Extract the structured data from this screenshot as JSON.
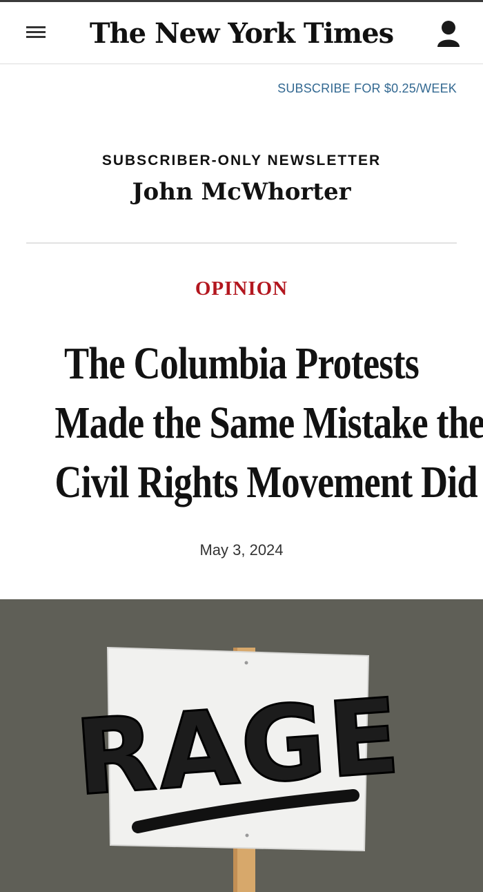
{
  "masthead": {
    "logo_text": "The New York Times",
    "menu_icon": "hamburger-menu-icon",
    "account_icon": "user-account-icon"
  },
  "subscribe": {
    "label": "SUBSCRIBE FOR $0.25/WEEK"
  },
  "newsletter": {
    "kicker": "SUBSCRIBER-ONLY NEWSLETTER",
    "author": "John McWhorter"
  },
  "article": {
    "section": "OPINION",
    "headline_lines": [
      "The Columbia Protests",
      "Made the Same Mistake the",
      "Civil Rights Movement Did"
    ],
    "date": "May 3, 2024"
  },
  "image": {
    "sign_text": "RAGE"
  },
  "colors": {
    "link": "#326891",
    "section": "#b3171f",
    "photo_bg": "#5f5f57"
  }
}
